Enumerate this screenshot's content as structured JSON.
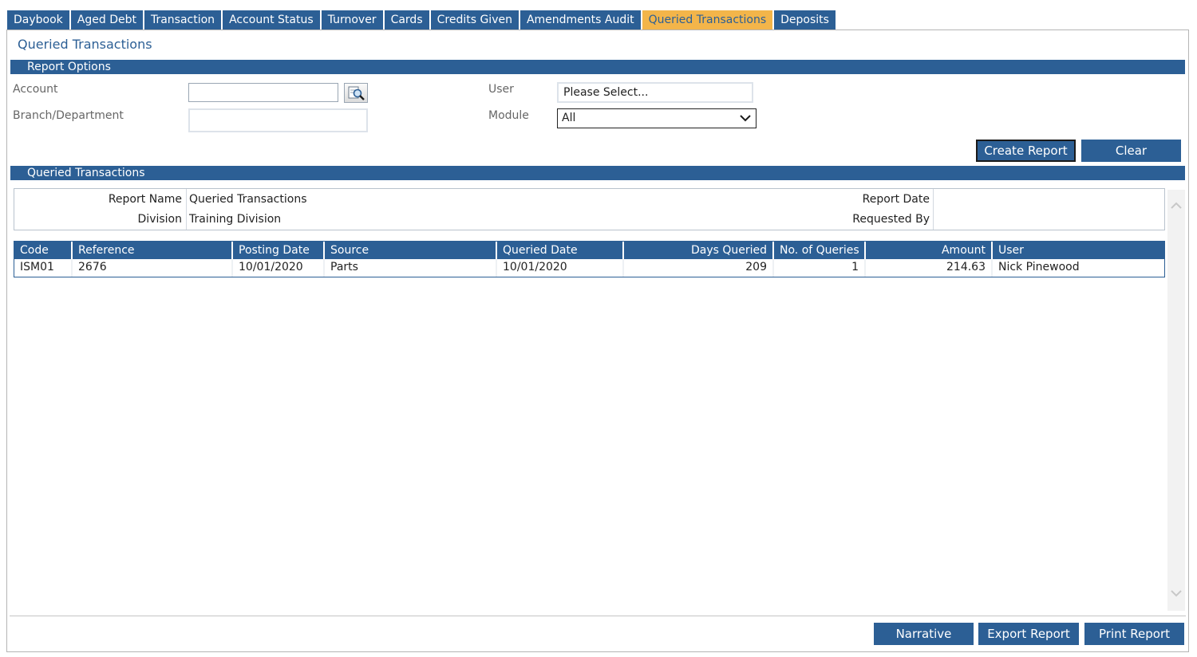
{
  "tabs": [
    {
      "label": "Daybook",
      "active": false
    },
    {
      "label": "Aged Debt",
      "active": false
    },
    {
      "label": "Transaction",
      "active": false
    },
    {
      "label": "Account Status",
      "active": false
    },
    {
      "label": "Turnover",
      "active": false
    },
    {
      "label": "Cards",
      "active": false
    },
    {
      "label": "Credits Given",
      "active": false
    },
    {
      "label": "Amendments Audit",
      "active": false
    },
    {
      "label": "Queried Transactions",
      "active": true
    },
    {
      "label": "Deposits",
      "active": false
    }
  ],
  "page_title": "Queried Transactions",
  "report_options": {
    "section_title": "Report Options",
    "account_label": "Account",
    "account_value": "",
    "branch_label": "Branch/Department",
    "branch_value": "",
    "user_label": "User",
    "user_value": "Please Select...",
    "module_label": "Module",
    "module_value": "All",
    "create_button": "Create Report",
    "clear_button": "Clear"
  },
  "results": {
    "section_title": "Queried Transactions",
    "report_name_label": "Report Name",
    "report_name_value": "Queried Transactions",
    "division_label": "Division",
    "division_value": "Training Division",
    "report_date_label": "Report Date",
    "report_date_value": "",
    "requested_by_label": "Requested By",
    "requested_by_value": "",
    "columns": [
      "Code",
      "Reference",
      "Posting Date",
      "Source",
      "Queried Date",
      "Days Queried",
      "No. of Queries",
      "Amount",
      "User"
    ],
    "rows": [
      [
        "ISM01",
        "2676",
        "10/01/2020",
        "Parts",
        "10/01/2020",
        "209",
        "1",
        "214.63",
        "Nick Pinewood"
      ]
    ]
  },
  "footer": {
    "narrative_button": "Narrative",
    "export_button": "Export Report",
    "print_button": "Print Report"
  },
  "colors": {
    "primary": "#2c5f95",
    "active_tab": "#f3b54a"
  },
  "icons": {
    "lookup": "magnifier-icon",
    "dropdown": "chevron-down-icon",
    "scroll_up": "chevron-up-icon",
    "scroll_down": "chevron-down-icon"
  }
}
